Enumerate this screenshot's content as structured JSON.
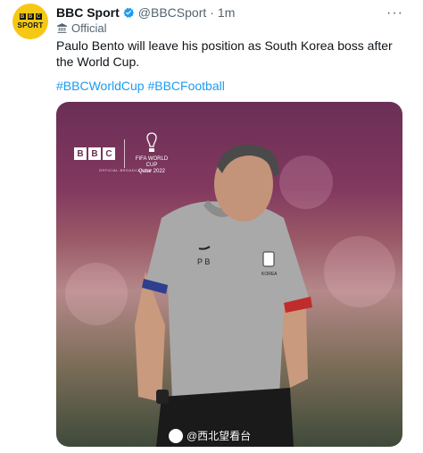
{
  "tweet": {
    "avatar": {
      "blocks": [
        "B",
        "B",
        "C"
      ],
      "label": "SPORT"
    },
    "author_name": "BBC Sport",
    "handle": "@BBCSport",
    "separator": "·",
    "time": "1m",
    "more": "···",
    "official_label": "Official",
    "text": "Paulo Bento will leave his position as South Korea boss after the World Cup.",
    "hashtags": [
      "#BBCWorldCup",
      "#BBCFootball"
    ]
  },
  "media": {
    "watermark_blocks": [
      "B",
      "B",
      "C"
    ],
    "worldcup_lines": [
      "FIFA WORLD CUP",
      "Qatar 2022"
    ],
    "watermark_sub": "OFFICIAL BROADCASTER",
    "shirt_initials": "P B",
    "badge_text": "KOREA",
    "credit": "@西北望看台"
  },
  "colors": {
    "accent": "#1d9bf0",
    "avatar_bg": "#f6c814",
    "muted": "#536471",
    "text": "#0f1419"
  }
}
